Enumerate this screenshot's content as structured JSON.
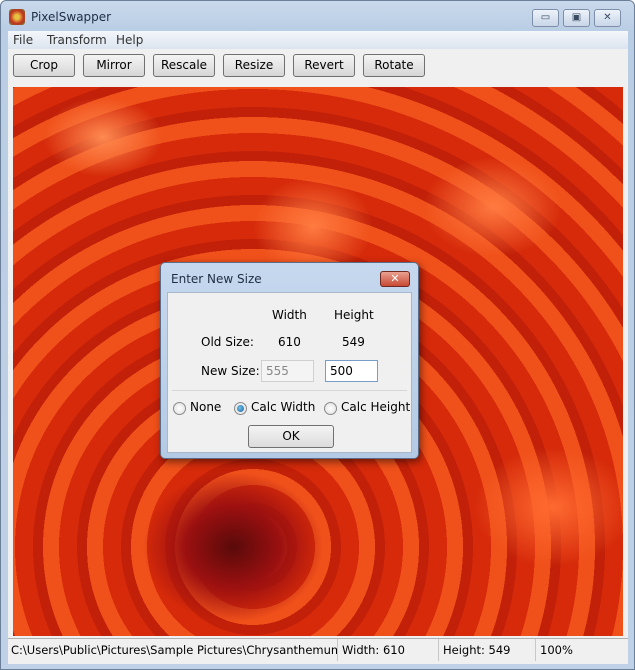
{
  "window": {
    "title": "PixelSwapper",
    "minimize": "▭",
    "maximize": "▣",
    "close": "✕"
  },
  "menu": [
    "File",
    "Transform",
    "Help"
  ],
  "toolbar": [
    "Crop",
    "Mirror",
    "Rescale",
    "Resize",
    "Revert",
    "Rotate"
  ],
  "status": {
    "path": "C:\\Users\\Public\\Pictures\\Sample Pictures\\Chrysanthemum...",
    "width": "Width: 610",
    "height": "Height: 549",
    "zoom": "100%"
  },
  "dialog": {
    "title": "Enter New Size",
    "close": "✕",
    "col_width": "Width",
    "col_height": "Height",
    "old_label": "Old Size:",
    "old_width": "610",
    "old_height": "549",
    "new_label": "New Size:",
    "new_width": "555",
    "new_height": "500",
    "radio_none": "None",
    "radio_calc_width": "Calc Width",
    "radio_calc_height": "Calc Height",
    "selected": "Calc Width",
    "ok": "OK"
  }
}
